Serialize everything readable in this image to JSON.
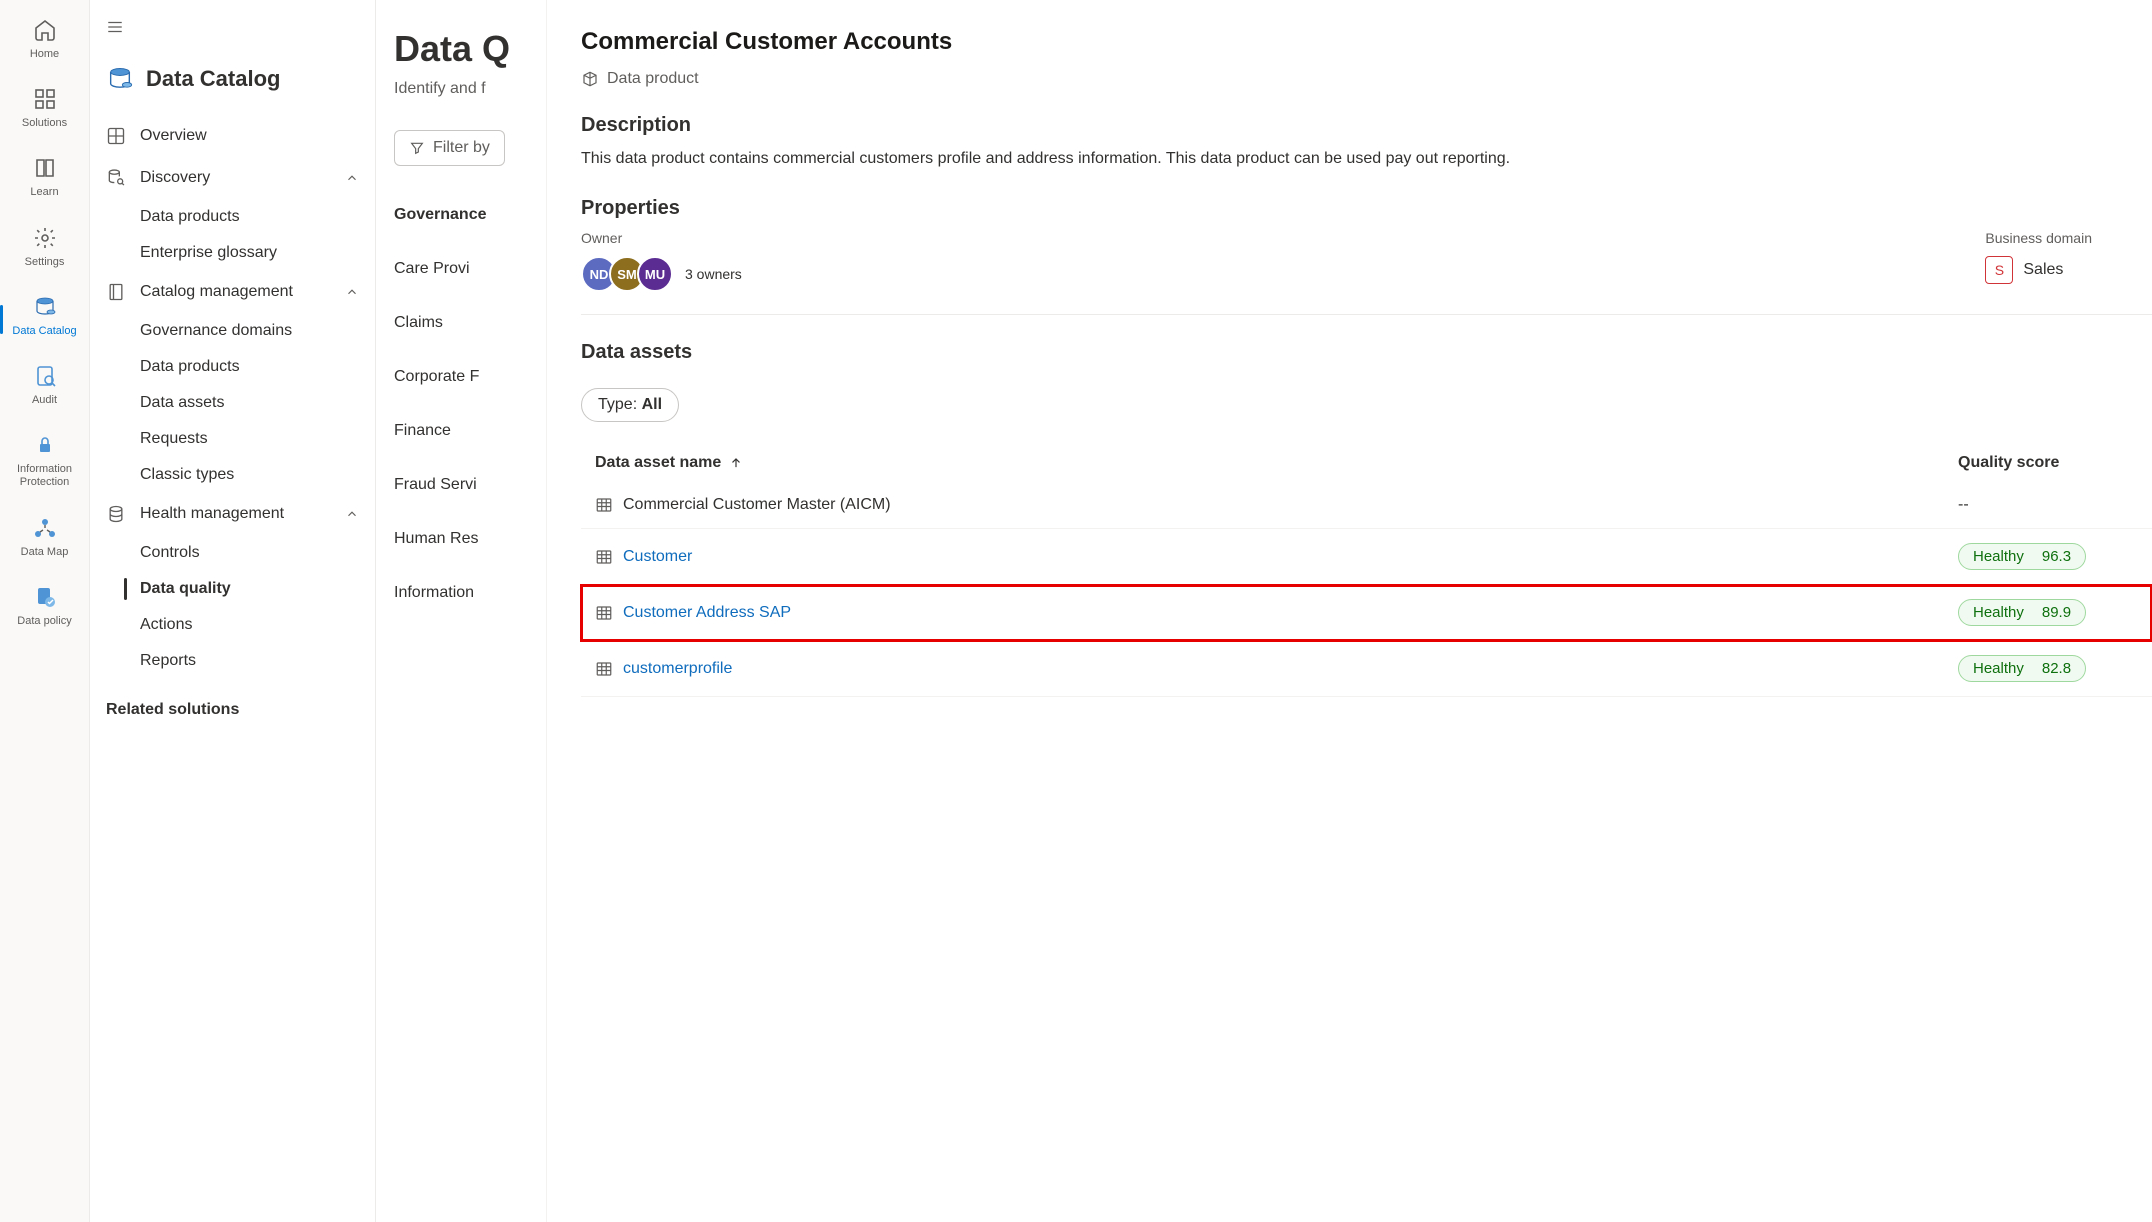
{
  "rail": {
    "items": [
      {
        "label": "Home",
        "icon": "home"
      },
      {
        "label": "Solutions",
        "icon": "apps"
      },
      {
        "label": "Learn",
        "icon": "book"
      },
      {
        "label": "Settings",
        "icon": "gear"
      },
      {
        "label": "Data Catalog",
        "icon": "catalog",
        "active": true
      },
      {
        "label": "Audit",
        "icon": "audit"
      },
      {
        "label": "Information Protection",
        "icon": "shield"
      },
      {
        "label": "Data Map",
        "icon": "map"
      },
      {
        "label": "Data policy",
        "icon": "policy"
      }
    ]
  },
  "sidebar": {
    "title": "Data Catalog",
    "overview": "Overview",
    "discovery": {
      "label": "Discovery",
      "children": [
        "Data products",
        "Enterprise glossary"
      ]
    },
    "catalog": {
      "label": "Catalog management",
      "children": [
        "Governance domains",
        "Data products",
        "Data assets",
        "Requests",
        "Classic types"
      ]
    },
    "health": {
      "label": "Health management",
      "children": [
        "Controls",
        "Data quality",
        "Actions",
        "Reports"
      ],
      "activeIndex": 1
    },
    "related": "Related solutions"
  },
  "middle": {
    "title": "Data Q",
    "subtitle": "Identify and f",
    "filter": "Filter by",
    "domainsHeading": "Governance",
    "domains": [
      "Care Provi",
      "Claims",
      "Corporate F",
      "Finance",
      "Fraud Servi",
      "Human Res",
      "Information"
    ]
  },
  "detail": {
    "title": "Commercial Customer Accounts",
    "type": "Data product",
    "descriptionHeading": "Description",
    "description": "This data product contains commercial customers profile and address information. This data product can be used pay out reporting.",
    "propertiesHeading": "Properties",
    "ownerLabel": "Owner",
    "owners": [
      {
        "initials": "ND",
        "color": "#5c6bc0"
      },
      {
        "initials": "SM",
        "color": "#8d6e1e"
      },
      {
        "initials": "MU",
        "color": "#5b2c92"
      }
    ],
    "ownersText": "3 owners",
    "bizLabel": "Business domain",
    "bizInitial": "S",
    "bizName": "Sales",
    "assetsHeading": "Data assets",
    "typeLabel": "Type: ",
    "typeValue": "All",
    "colName": "Data asset name",
    "colScore": "Quality score",
    "assets": [
      {
        "name": "Commercial Customer Master (AICM)",
        "link": false,
        "score": "--",
        "status": null
      },
      {
        "name": "Customer",
        "link": true,
        "score": "96.3",
        "status": "Healthy"
      },
      {
        "name": "Customer Address SAP",
        "link": true,
        "score": "89.9",
        "status": "Healthy",
        "highlighted": true
      },
      {
        "name": "customerprofile",
        "link": true,
        "score": "82.8",
        "status": "Healthy"
      }
    ]
  }
}
